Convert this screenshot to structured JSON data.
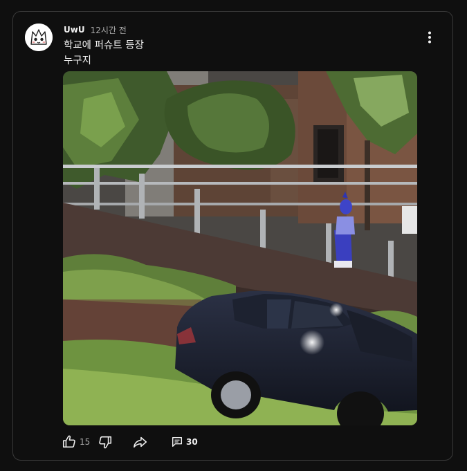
{
  "post": {
    "author": "UwU",
    "timestamp": "12시간 전",
    "text_line1": "학교에 퍼슈트 등장",
    "text_line2": "누구지"
  },
  "actions": {
    "like_count": "15",
    "comment_count": "30"
  },
  "icons": {
    "menu": "more-vertical-icon",
    "like": "thumb-up-icon",
    "dislike": "thumb-down-icon",
    "share": "share-icon",
    "comment": "comment-icon"
  },
  "colors": {
    "background": "#0f0f0f",
    "border": "#3a3a3a",
    "text_primary": "#f1f1f1",
    "text_secondary": "#aaaaaa"
  }
}
